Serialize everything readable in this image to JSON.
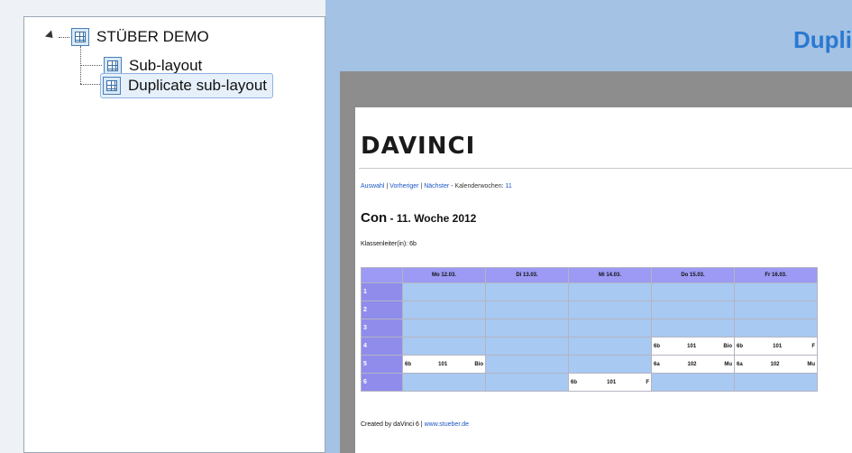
{
  "tree": {
    "root": {
      "label": "STÜBER DEMO"
    },
    "children": [
      {
        "label": "Sub-layout"
      },
      {
        "label": "Duplicate sub-layout"
      }
    ]
  },
  "header": {
    "title": "Dupli"
  },
  "document": {
    "logo": "DAVINCI",
    "nav": {
      "auswahl": "Auswahl",
      "sep1": " | ",
      "vorheriger": "Vorheriger",
      "sep2": " | ",
      "naechster": "Nächster",
      "kw_label": " - Kalenderwochen: ",
      "kw_value": "11"
    },
    "heading": {
      "name": "Con",
      "week": " - 11. Woche 2012"
    },
    "teacher": "Klassenleiter(in): 6b",
    "table": {
      "days": [
        "Mo 12.03.",
        "Di 13.03.",
        "Mi 14.03.",
        "Do 15.03.",
        "Fr 16.03."
      ],
      "rows": [
        {
          "num": "1",
          "cells": [
            null,
            null,
            null,
            null,
            null
          ]
        },
        {
          "num": "2",
          "cells": [
            null,
            null,
            null,
            null,
            null
          ]
        },
        {
          "num": "3",
          "cells": [
            null,
            null,
            null,
            null,
            null
          ]
        },
        {
          "num": "4",
          "cells": [
            null,
            null,
            null,
            [
              "6b",
              "101",
              "Bio"
            ],
            [
              "6b",
              "101",
              "F"
            ]
          ]
        },
        {
          "num": "5",
          "cells": [
            [
              "6b",
              "101",
              "Bio"
            ],
            null,
            null,
            [
              "6a",
              "102",
              "Mu"
            ],
            [
              "6a",
              "102",
              "Mu"
            ]
          ]
        },
        {
          "num": "6",
          "cells": [
            null,
            null,
            [
              "6b",
              "101",
              "F"
            ],
            null,
            null
          ]
        }
      ]
    },
    "footer": {
      "text": "Created by daVinci 6 | ",
      "link": "www.stueber.de"
    }
  }
}
